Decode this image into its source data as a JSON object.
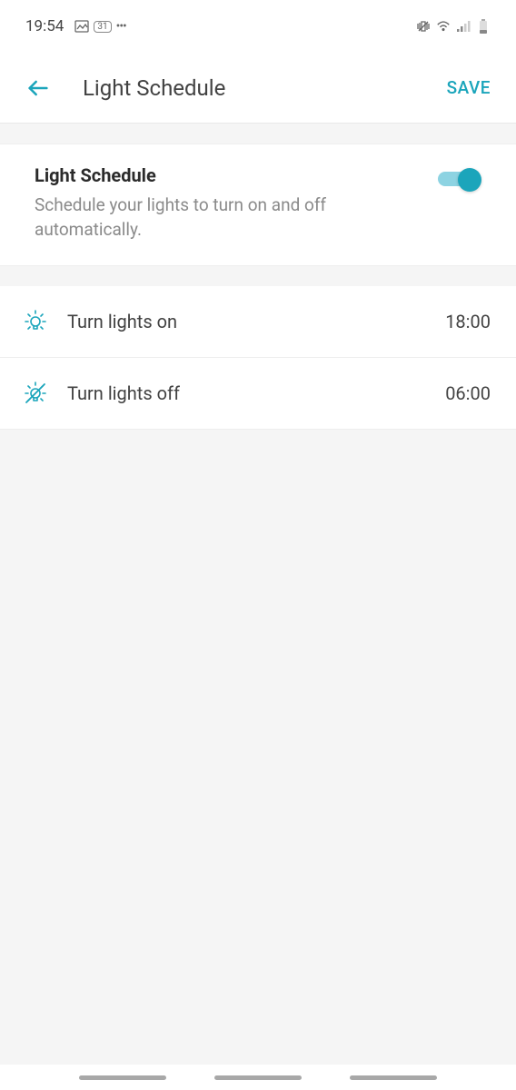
{
  "status": {
    "time": "19:54",
    "badge": "31"
  },
  "header": {
    "title": "Light Schedule",
    "save": "SAVE"
  },
  "schedule_card": {
    "title": "Light Schedule",
    "description": "Schedule your lights to turn on and off automatically.",
    "enabled": true
  },
  "rows": {
    "on": {
      "label": "Turn lights on",
      "time": "18:00"
    },
    "off": {
      "label": "Turn lights off",
      "time": "06:00"
    }
  }
}
